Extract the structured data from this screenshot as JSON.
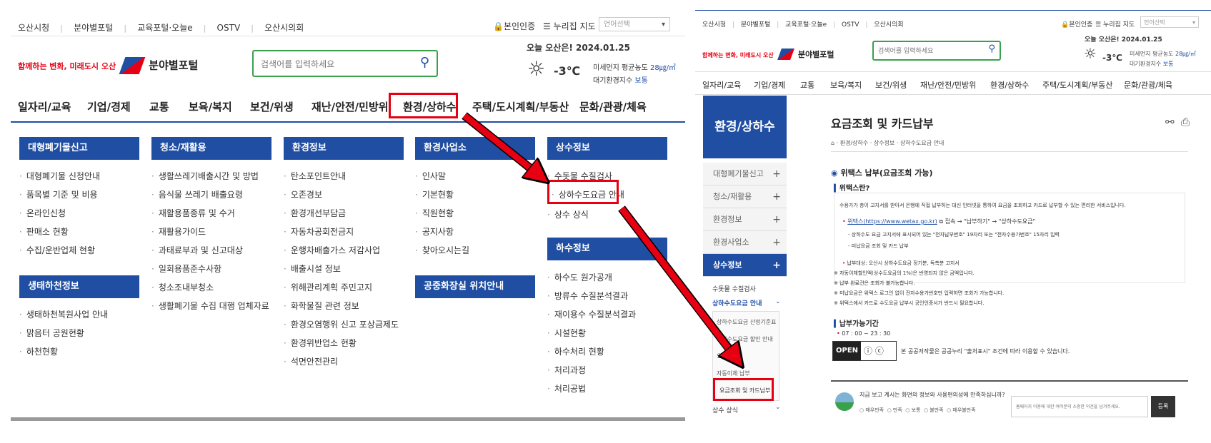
{
  "left": {
    "util_links": [
      "오산시청",
      "분야별포털",
      "교육포털·오늘e",
      "OSTV",
      "오산시의회"
    ],
    "auth": "본인인증",
    "sitemap": "누리집 지도",
    "lang_placeholder": "언어선택",
    "logo_slogan": "함께하는 변화, 미래도시 오산",
    "logo_title": "분야별포털",
    "search_placeholder": "검색어를 입력하세요",
    "weather_title": "오늘 오산은! 2024.01.25",
    "temperature": "-3℃",
    "dust_label": "미세먼지 평균농도",
    "dust_value": "28㎍/㎥",
    "air_label": "대기환경지수",
    "air_value": "보통",
    "nav": [
      "일자리/교육",
      "기업/경제",
      "교통",
      "보육/복지",
      "보건/위생",
      "재난/안전/민방위",
      "환경/상하수",
      "주택/도시계획/부동산",
      "문화/관광/체육"
    ],
    "cols": [
      {
        "head": "대형폐기물신고",
        "items": [
          "대형폐기물 신청안내",
          "품목별 기준 및 비용",
          "온라인신청",
          "판매소 현황",
          "수집/운반업체 현황"
        ]
      },
      {
        "head": "청소/재활용",
        "items": [
          "생활쓰레기배출시간 및 방법",
          "음식물 쓰레기 배출요령",
          "재활용품종류 및 수거",
          "재활용가이드",
          "과태료부과 및 신고대상",
          "일회용품준수사항",
          "청소조내부청소",
          "생활폐기물 수집 대행 업체자료"
        ]
      },
      {
        "head": "환경정보",
        "items": [
          "탄소포인트안내",
          "오존경보",
          "환경개선부담금",
          "자동차공회전금지",
          "운행차배출가스 저감사업",
          "배출시설 정보",
          "위해관리계획 주민고지",
          "화학물질 관련 정보",
          "환경오염행위 신고 포상금제도",
          "환경위반업소 현황",
          "석면안전관리"
        ]
      },
      {
        "head": "환경사업소",
        "items": [
          "인사말",
          "기본현황",
          "직원현황",
          "공지사항",
          "찾아오시는길"
        ]
      },
      {
        "head": "상수정보",
        "items": [
          "수돗물 수질검사",
          "상하수도요금 안내",
          "상수 상식"
        ]
      }
    ],
    "col2_head": "생태하천정보",
    "col2_items": [
      "생태하천복원사업 안내",
      "맑음터 공원현황",
      "하천현황"
    ],
    "col4_head2": "공중화장실 위치안내",
    "col5_head2": "하수정보",
    "col5_items2": [
      "하수도 원가공개",
      "방류수 수질분석결과",
      "재이용수 수질분석결과",
      "시설현황",
      "하수처리 현황",
      "처리과정",
      "처리공법"
    ]
  },
  "right": {
    "util_links": [
      "오산시청",
      "분야별포털",
      "교육포털·오늘e",
      "OSTV",
      "오산시의회"
    ],
    "auth": "본인인증",
    "sitemap": "누리집 지도",
    "lang_placeholder": "언어선택",
    "logo_slogan": "함께하는 변화, 미래도시 오산",
    "logo_title": "분야별포털",
    "search_placeholder": "검색어를 입력하세요",
    "weather_title": "오늘 오산은! 2024.01.25",
    "temperature": "-3℃",
    "dust_label": "미세먼지 평균농도",
    "dust_value": "28㎍/㎥",
    "air_label": "대기환경지수",
    "air_value": "보통",
    "nav": [
      "일자리/교육",
      "기업/경제",
      "교통",
      "보육/복지",
      "보건/위생",
      "재난/안전/민방위",
      "환경/상하수",
      "주택/도시계획/부동산",
      "문화/관광/체육"
    ],
    "side_title": "환경/상하수",
    "side_items": [
      "대형폐기물신고",
      "청소/재활용",
      "환경정보",
      "환경사업소"
    ],
    "side_active": "상수정보",
    "side_sub": [
      "수돗물 수질검사",
      "상하수도요금 안내"
    ],
    "side_sub2": [
      "상하수도요금 산정기준표",
      "상하수도요금 할인 안내",
      "요금",
      "자동이체 납부",
      "요금조회 및 카드납부"
    ],
    "side_last": "상수 상식",
    "page_title": "요금조회 및 카드납부",
    "breadcrumb": [
      "환경/상하수",
      "상수정보",
      "상하수도요금 안내"
    ],
    "section_title": "위택스 납부(요금조회 가능)",
    "sub_title1": "위택스란?",
    "desc": "수용가가 총이 고지서를 받아서 은행에 직접 납부하는 대신 인터넷을 통하여 요금을 조회하고 카드로 납부할 수 있는 편리한 서비스입니다.",
    "step_link": "위택스(https://www.wetax.go.kr)",
    "step_rest": "접속 → \"납부하기\" → \"상하수도요금\"",
    "bullet1": "상하수도 요금 고지서에 표시되어 있는 \"전자납부번호\" 19자리 또는 \"전자수용가번호\" 15자리 입력",
    "bullet2": "미납요금 조회 및 카드 납부",
    "target": "납부대상: 오산시 상하수도요금 정기분, 독촉분 고지서",
    "notes": [
      "※ 자동이체할인액(상수도요금의 1%)은 반영되지 않은 금액입니다.",
      "※ 납부 완료건은 조회가 불가능합니다.",
      "※ 미납요금은 위택스 로그인 없이 전자수용가번호만 입력하면 조회가 가능합니다.",
      "※ 위택스에서 카드로 수도요금 납부시 공인인증서가 반드시 필요합니다."
    ],
    "sub_title2": "납부가능기간",
    "period": "07 : 00 ~ 23 : 30",
    "open_label": "OPEN",
    "license_text": "본 공공저작물은 공공누리 \"출처표시\" 조건에 따라 이용할 수 있습니다.",
    "survey_q": "지금 보고 계시는 화면의 정보와 사용편의성에 만족하십니까?",
    "survey_opts": [
      "매우만족",
      "만족",
      "보통",
      "불만족",
      "매우불만족"
    ],
    "survey_placeholder": "홈페이지 이용에 대한 여러분의 소중한 의견을 남겨주세요.",
    "survey_submit": "등록"
  },
  "colors": {
    "accent": "#1f4ea3",
    "red": "#e60012",
    "search_border": "#3aa14b"
  }
}
